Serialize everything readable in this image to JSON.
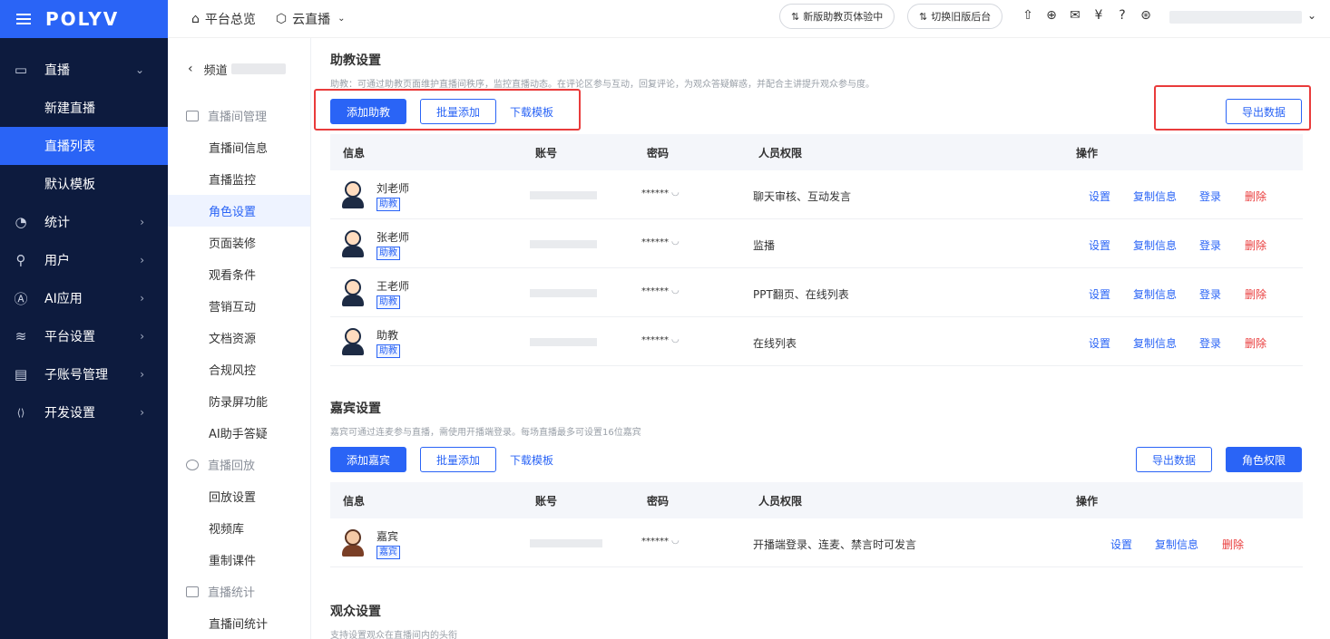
{
  "brand": {
    "logo": "POLYV"
  },
  "leftnav": {
    "items": [
      {
        "icon": "video-icon",
        "glyph": "▭",
        "label": "直播",
        "chev": "⌄"
      },
      {
        "label": "新建直播"
      },
      {
        "label": "直播列表"
      },
      {
        "label": "默认模板"
      },
      {
        "icon": "stats-icon",
        "glyph": "◔",
        "label": "统计",
        "chev": "›"
      },
      {
        "icon": "user-icon",
        "glyph": "⚲",
        "label": "用户",
        "chev": "›"
      },
      {
        "icon": "ai-icon",
        "glyph": "Ⓐ",
        "label": "AI应用",
        "chev": "›"
      },
      {
        "icon": "layers-icon",
        "glyph": "≋",
        "label": "平台设置",
        "chev": "›"
      },
      {
        "icon": "account-icon",
        "glyph": "▤",
        "label": "子账号管理",
        "chev": "›"
      },
      {
        "icon": "code-icon",
        "glyph": "⟨⟩",
        "label": "开发设置",
        "chev": "›"
      }
    ]
  },
  "topbar": {
    "home": "平台总览",
    "cloud": "云直播",
    "pill1": "新版助教页体验中",
    "pill2": "切换旧版后台"
  },
  "subnav": {
    "back_label": "频道",
    "groups": [
      {
        "label": "直播间管理",
        "items": [
          "直播间信息",
          "直播监控",
          "角色设置",
          "页面装修",
          "观看条件",
          "营销互动",
          "文档资源",
          "合规风控",
          "防录屏功能",
          "AI助手答疑"
        ]
      },
      {
        "label": "直播回放",
        "items": [
          "回放设置",
          "视频库",
          "重制课件"
        ]
      },
      {
        "label": "直播统计",
        "items": [
          "直播间统计"
        ]
      }
    ]
  },
  "assistant": {
    "title": "助教设置",
    "desc": "助教：可通过助教页面维护直播间秩序，监控直播动态。在评论区参与互动，回复评论，为观众答疑解惑，并配合主讲提升观众参与度。",
    "add": "添加助教",
    "batch": "批量添加",
    "template": "下载模板",
    "export": "导出数据",
    "headers": {
      "info": "信息",
      "account": "账号",
      "password": "密码",
      "perm": "人员权限",
      "ops": "操作"
    },
    "rows": [
      {
        "name": "刘老师",
        "role": "助教",
        "pwd": "******",
        "perm": "聊天审核、互动发言"
      },
      {
        "name": "张老师",
        "role": "助教",
        "pwd": "******",
        "perm": "监播"
      },
      {
        "name": "王老师",
        "role": "助教",
        "pwd": "******",
        "perm": "PPT翻页、在线列表"
      },
      {
        "name": "助教",
        "role": "助教",
        "pwd": "******",
        "perm": "在线列表"
      }
    ],
    "ops": {
      "set": "设置",
      "copy": "复制信息",
      "login": "登录",
      "del": "删除"
    }
  },
  "guest": {
    "title": "嘉宾设置",
    "desc": "嘉宾可通过连麦参与直播，需使用开播端登录。每场直播最多可设置16位嘉宾",
    "add": "添加嘉宾",
    "batch": "批量添加",
    "template": "下载模板",
    "export": "导出数据",
    "roleperm": "角色权限",
    "headers": {
      "info": "信息",
      "account": "账号",
      "password": "密码",
      "perm": "人员权限",
      "ops": "操作"
    },
    "rows": [
      {
        "name": "嘉宾",
        "role": "嘉宾",
        "pwd": "******",
        "perm": "开播端登录、连麦、禁言时可发言"
      }
    ],
    "ops": {
      "set": "设置",
      "copy": "复制信息",
      "del": "删除"
    }
  },
  "audience": {
    "title": "观众设置",
    "desc": "支持设置观众在直播间内的头衔"
  }
}
